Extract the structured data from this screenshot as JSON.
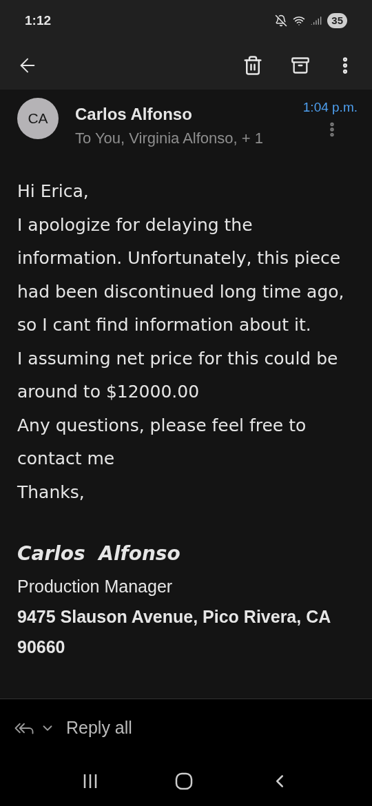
{
  "status_bar": {
    "time": "1:12",
    "battery": "35"
  },
  "message": {
    "avatar_initials": "CA",
    "sender": "Carlos Alfonso",
    "recipients": "To You, Virginia Alfonso, + 1",
    "time": "1:04 p.m.",
    "body": [
      "Hi Erica,",
      "I apologize for delaying the information. Unfortunately, this piece had been discontinued long time ago, so I cant find information about it.",
      "I assuming net price for this could be around to $12000.00",
      "Any questions, please feel free to contact me",
      "Thanks,"
    ],
    "signature": {
      "name": "Carlos  Alfonso",
      "title": "Production Manager",
      "address": "9475 Slauson Avenue, Pico Rivera, CA 90660"
    }
  },
  "reply_bar": {
    "label": "Reply all"
  }
}
